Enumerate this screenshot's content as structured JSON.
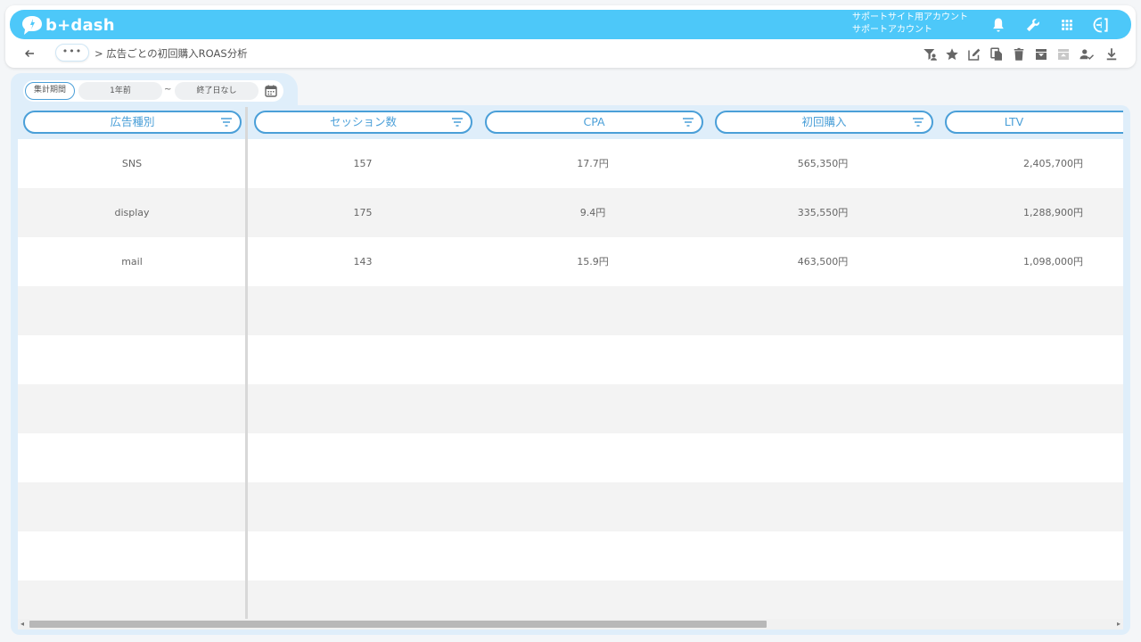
{
  "app": {
    "logo_text": "b+dash",
    "account_line1": "サポートサイト用アカウント",
    "account_line2": "サポートアカウント"
  },
  "breadcrumb": {
    "more": "•••",
    "separator": ">",
    "current": "広告ごとの初回購入ROAS分析"
  },
  "period": {
    "label": "集計期間",
    "start": "1年前",
    "tilde": "~",
    "end": "終了日なし"
  },
  "table": {
    "columns": [
      "広告種別",
      "セッション数",
      "CPA",
      "初回購入",
      "LTV"
    ],
    "rows": [
      [
        "SNS",
        "157",
        "17.7円",
        "565,350円",
        "2,405,700円"
      ],
      [
        "display",
        "175",
        "9.4円",
        "335,550円",
        "1,288,900円"
      ],
      [
        "mail",
        "143",
        "15.9円",
        "463,500円",
        "1,098,000円"
      ]
    ]
  },
  "colors": {
    "brand": "#4dc8f9",
    "accent": "#4a9fd8",
    "panel": "#dfeefa"
  },
  "icons": {
    "header": [
      "bell-icon",
      "wrench-icon",
      "apps-grid-icon",
      "logout-icon"
    ],
    "toolbar": [
      "filter-user-icon",
      "star-icon",
      "edit-icon",
      "copy-icon",
      "trash-icon",
      "archive-icon",
      "unarchive-icon",
      "user-check-icon",
      "download-icon"
    ]
  }
}
